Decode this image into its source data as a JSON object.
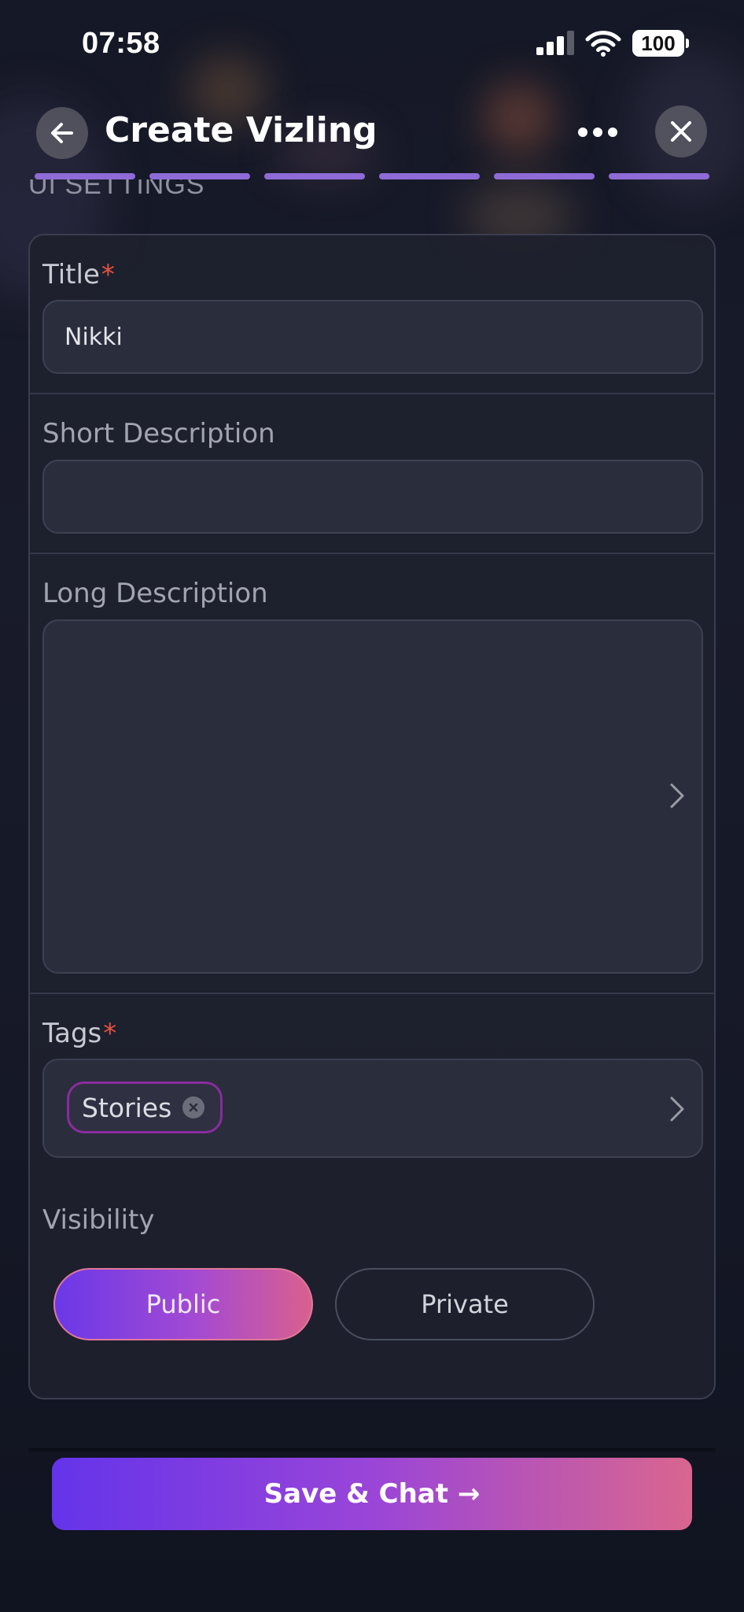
{
  "status_bar": {
    "time": "07:58",
    "battery": "100",
    "icons": [
      "signal-icon",
      "wifi-icon",
      "battery-icon"
    ]
  },
  "header": {
    "title": "Create Vizling",
    "icons": [
      "back-arrow-icon",
      "more-dots-icon",
      "close-icon"
    ],
    "progress": {
      "total_steps": 6,
      "completed_steps": 6,
      "color": "#8e6bd6"
    }
  },
  "section_heading": "UI SETTINGS",
  "form": {
    "title": {
      "label": "Title",
      "required_mark": "*",
      "value": "Nikki"
    },
    "short_description": {
      "label": "Short Description",
      "value": ""
    },
    "long_description": {
      "label": "Long Description",
      "value": ""
    },
    "tags": {
      "label": "Tags",
      "required_mark": "*",
      "items": [
        "Stories"
      ]
    },
    "visibility": {
      "label": "Visibility",
      "options": [
        "Public",
        "Private"
      ],
      "selected": "Public"
    }
  },
  "actions": {
    "save_chat": "Save & Chat →"
  },
  "colors": {
    "accent_gradient_start": "#6434ea",
    "accent_gradient_end": "#d9668f",
    "required": "#e5533f",
    "tag_border": "#8a2c9e"
  }
}
